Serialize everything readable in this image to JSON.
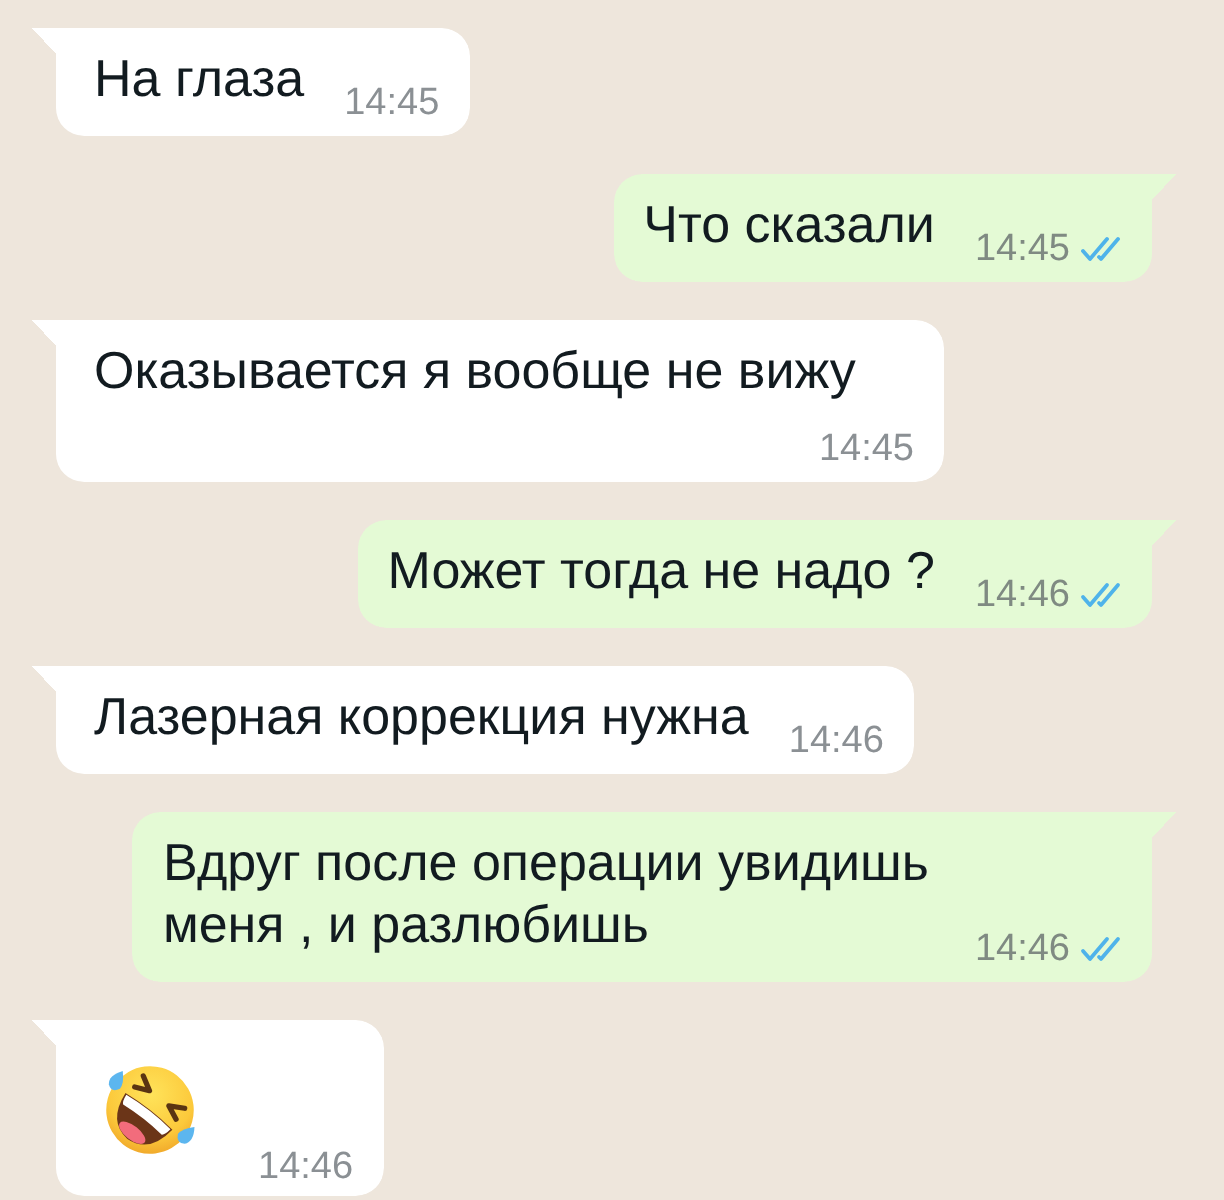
{
  "messages": [
    {
      "kind": "text",
      "outgoing": false,
      "text": "На глаза",
      "time": "14:45"
    },
    {
      "kind": "text",
      "outgoing": true,
      "text": "Что сказали",
      "time": "14:45",
      "read": true
    },
    {
      "kind": "text",
      "outgoing": false,
      "text": "Оказывается я вообще не вижу",
      "time": "14:45"
    },
    {
      "kind": "text",
      "outgoing": true,
      "text": "Может тогда не надо ?",
      "time": "14:46",
      "read": true
    },
    {
      "kind": "text",
      "outgoing": false,
      "text": "Лазерная коррекция нужна",
      "time": "14:46"
    },
    {
      "kind": "text",
      "outgoing": true,
      "text": "Вдруг после операции увидишь меня , и разлюбишь",
      "time": "14:46",
      "read": true
    },
    {
      "kind": "emoji",
      "outgoing": false,
      "time": "14:46"
    }
  ]
}
